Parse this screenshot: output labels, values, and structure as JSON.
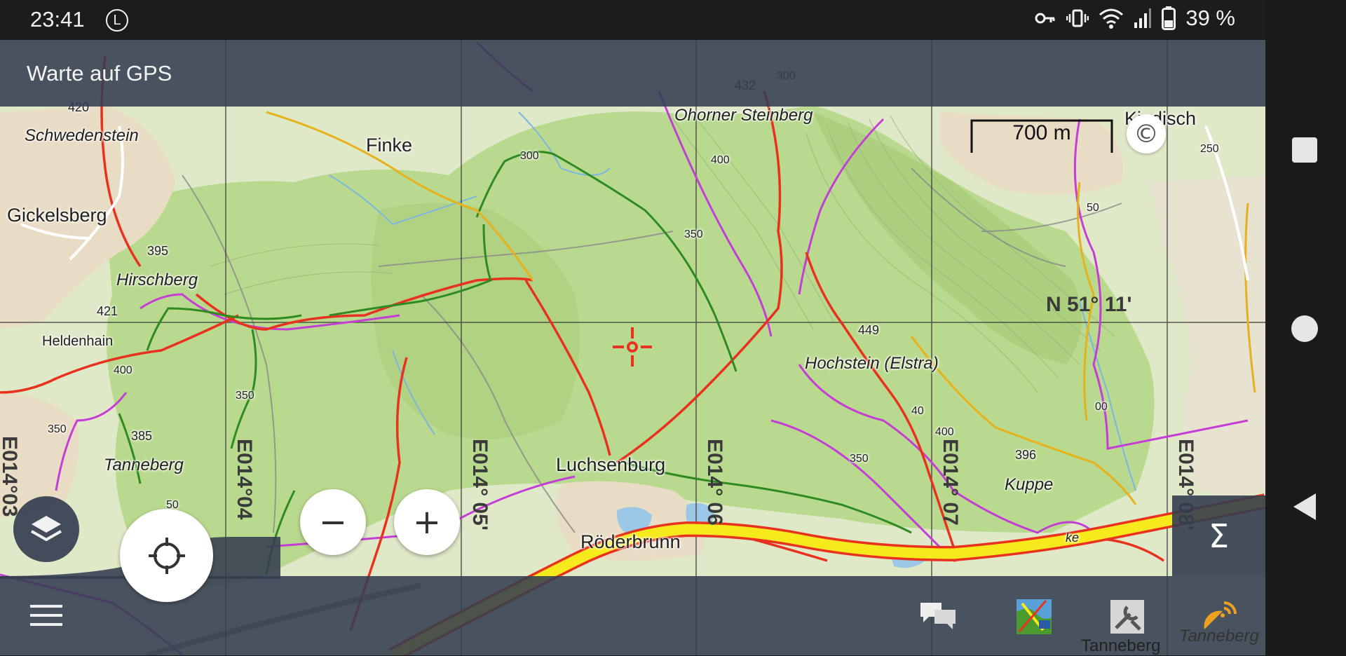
{
  "status_bar": {
    "time": "23:41",
    "l_indicator": "L",
    "battery": "39 %",
    "icons": [
      "vpn-key-icon",
      "vibrate-icon",
      "wifi-icon",
      "signal-icon",
      "battery-icon"
    ]
  },
  "app_bar": {
    "title": "Warte auf GPS"
  },
  "scale_bar": {
    "label": "700 m"
  },
  "copyright_symbol": "©",
  "sigma_label": "Σ",
  "grid_labels": {
    "lat": "N 51° 11'",
    "lon": [
      "E014°03",
      "E014°04",
      "E014° 05'",
      "E014° 06",
      "E014° 07",
      "E014° 08'"
    ]
  },
  "places": {
    "finke": "Finke",
    "gickelsberg": "Gickelsberg",
    "schwedenstein": "Schwedenstein",
    "hirschberg": "Hirschberg",
    "heldenhain": "Heldenhain",
    "tanneberg": "Tanneberg",
    "luchsenburg": "Luchsenburg",
    "roederbrunn": "Röderbrunn",
    "ohorner_steinberg": "Ohorner Steinberg",
    "hochstein": "Hochstein (Elstra)",
    "kuppe": "Kuppe",
    "kindisch": "Kindisch",
    "tanneberg_bottom": "Tanneberg",
    "tanneberg_bottom_italic": "Tanneberg",
    "ke": "ke"
  },
  "elevations": {
    "e420": "420",
    "e395": "395",
    "e421": "421",
    "e400a": "400",
    "e350a": "350",
    "e385": "385",
    "e50a": "50",
    "e350b": "350",
    "e300": "300",
    "e400b": "400",
    "e350c": "350",
    "e432": "432",
    "e300b": "300",
    "e449": "449",
    "e400c": "400",
    "e350d": "350",
    "e396": "396",
    "e250": "250",
    "e50b": "50",
    "e40": "40",
    "e00": "00"
  },
  "buttons": {
    "zoom_out": "−",
    "zoom_in": "+"
  },
  "colors": {
    "bar": "#343e50",
    "forest": "#b9d98e",
    "road_yellow": "#f7ea1c",
    "road_red": "#e8321e",
    "trail_purple": "#c43ed6",
    "trail_green": "#2e8b1f"
  }
}
